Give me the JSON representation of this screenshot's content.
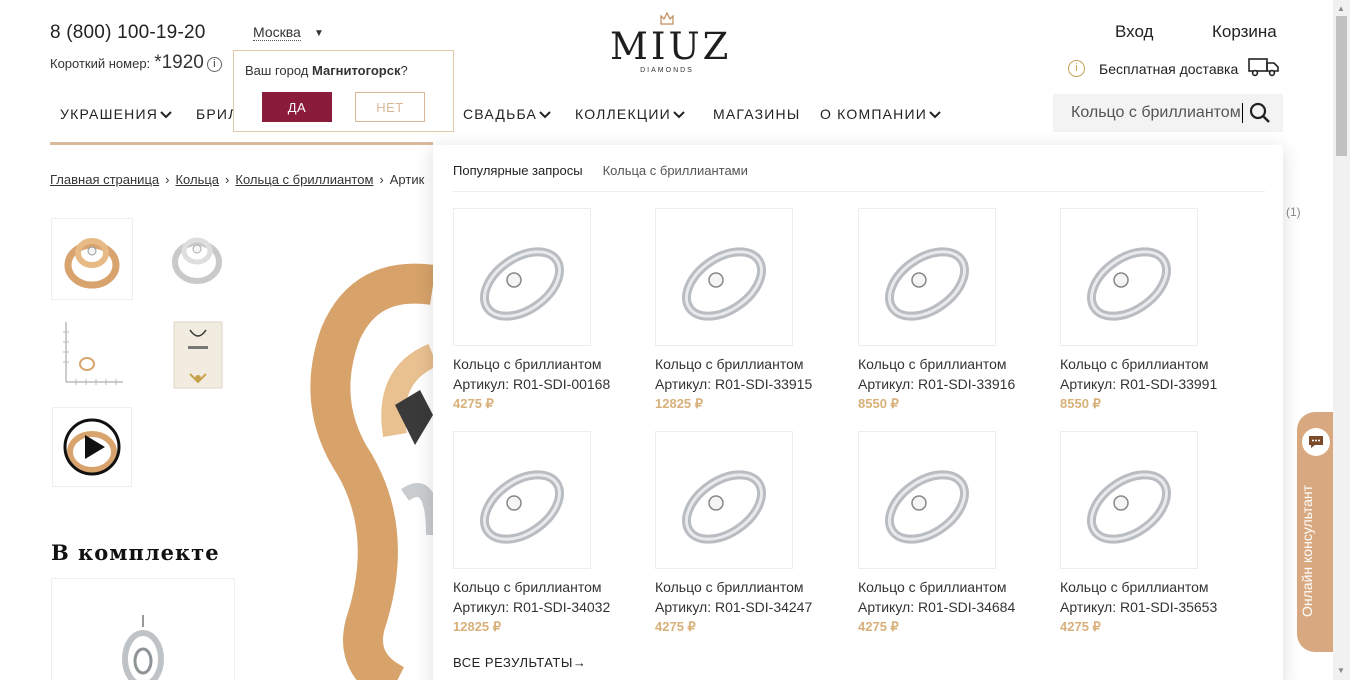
{
  "header": {
    "phone": "8 (800) 100-19-20",
    "short_label": "Короткий номер:",
    "short_number": "*1920",
    "info_glyph": "i",
    "city": "Москва",
    "login": "Вход",
    "cart": "Корзина",
    "delivery": "Бесплатная доставка"
  },
  "logo": {
    "text": "MIUZ",
    "sub": "DIAMONDS"
  },
  "city_popup": {
    "question_prefix": "Ваш город",
    "city": "Магнитогорск",
    "question_suffix": "?",
    "yes": "ДА",
    "no": "НЕТ"
  },
  "nav": {
    "items": [
      {
        "label": "УКРАШЕНИЯ"
      },
      {
        "label": "БРИЛ"
      },
      {
        "label": "СВАДЬБА"
      },
      {
        "label": "КОЛЛЕКЦИИ"
      },
      {
        "label": "МАГАЗИНЫ"
      },
      {
        "label": "О КОМПАНИИ"
      }
    ]
  },
  "search": {
    "value": "Кольцо с бриллиантом"
  },
  "breadcrumb": {
    "items": [
      "Главная страница",
      "Кольца",
      "Кольца с бриллиантом",
      "Артик"
    ]
  },
  "product_page": {
    "set_title": "В комплекте",
    "review_count": "(1)"
  },
  "dropdown": {
    "popular_label": "Популярные запросы",
    "popular_tag": "Кольца с бриллиантами",
    "all_results": "ВСЕ РЕЗУЛЬТАТЫ→",
    "products": [
      {
        "name": "Кольцо с бриллиантом",
        "article": "Артикул: R01-SDI-00168",
        "price": "4275 ₽"
      },
      {
        "name": "Кольцо с бриллиантом",
        "article": "Артикул: R01-SDI-33915",
        "price": "12825 ₽"
      },
      {
        "name": "Кольцо с бриллиантом",
        "article": "Артикул: R01-SDI-33916",
        "price": "8550 ₽"
      },
      {
        "name": "Кольцо с бриллиантом",
        "article": "Артикул: R01-SDI-33991",
        "price": "8550 ₽"
      },
      {
        "name": "Кольцо с бриллиантом",
        "article": "Артикул: R01-SDI-34032",
        "price": "12825 ₽"
      },
      {
        "name": "Кольцо с бриллиантом",
        "article": "Артикул: R01-SDI-34247",
        "price": "4275 ₽"
      },
      {
        "name": "Кольцо с бриллиантом",
        "article": "Артикул: R01-SDI-34684",
        "price": "4275 ₽"
      },
      {
        "name": "Кольцо с бриллиантом",
        "article": "Артикул: R01-SDI-35653",
        "price": "4275 ₽"
      }
    ]
  },
  "consultant": {
    "label": "Онлайн консультант"
  },
  "colors": {
    "accent": "#8b1b3a",
    "gold": "#d8b99a",
    "price": "#d8b07a"
  },
  "icons": [
    "crown-icon",
    "info-icon",
    "truck-icon",
    "search-icon",
    "chevron-down-icon",
    "play-icon",
    "chat-icon"
  ]
}
